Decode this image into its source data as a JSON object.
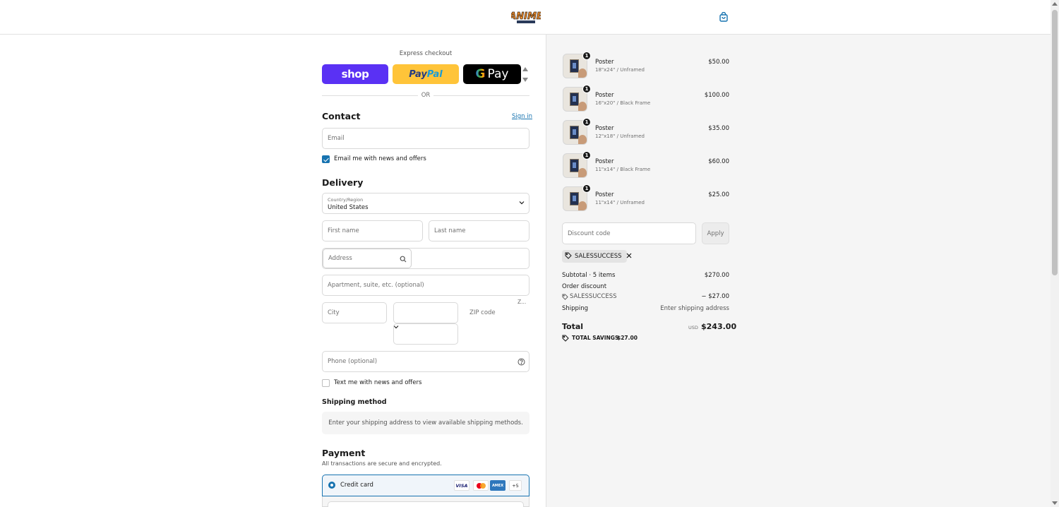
{
  "header": {
    "logo_text": "ANIME",
    "logo_sub": "ARTWORKS"
  },
  "express": {
    "label": "Express checkout",
    "shop": "shop",
    "paypal_a": "Pay",
    "paypal_b": "Pal",
    "gpay_g": "G",
    "gpay": "Pay",
    "or": "OR"
  },
  "contact": {
    "title": "Contact",
    "sign_in": "Sign in",
    "email_placeholder": "Email",
    "news_label": "Email me with news and offers"
  },
  "delivery": {
    "title": "Delivery",
    "country_label": "Country/Region",
    "country_value": "United States",
    "first_name": "First name",
    "last_name": "Last name",
    "address": "Address",
    "apartment": "Apartment, suite, etc. (optional)",
    "city": "City",
    "zip": "ZIP code",
    "zip_trunc": "Z...",
    "phone": "Phone (optional)",
    "text_label": "Text me with news and offers"
  },
  "shipping": {
    "title": "Shipping method",
    "info": "Enter your shipping address to view available shipping methods."
  },
  "payment": {
    "title": "Payment",
    "subtitle": "All transactions are secure and encrypted.",
    "credit_card": "Credit card",
    "visa": "VISA",
    "amex": "AMEX",
    "more": "+5"
  },
  "cart": {
    "items": [
      {
        "qty": "1",
        "name": "Poster",
        "variant": "18\"x24\" / Unframed",
        "price": "$50.00"
      },
      {
        "qty": "1",
        "name": "Poster",
        "variant": "16\"x20\" / Black Frame",
        "price": "$100.00"
      },
      {
        "qty": "1",
        "name": "Poster",
        "variant": "12\"x18\" / Unframed",
        "price": "$35.00"
      },
      {
        "qty": "1",
        "name": "Poster",
        "variant": "11\"x14\" / Black Frame",
        "price": "$60.00"
      },
      {
        "qty": "1",
        "name": "Poster",
        "variant": "11\"x14\" / Unframed",
        "price": "$25.00"
      }
    ],
    "discount_placeholder": "Discount code",
    "apply": "Apply",
    "applied_code": "SALESSUCCESS",
    "subtotal_label": "Subtotal · 5 items",
    "subtotal_value": "$270.00",
    "order_discount_label": "Order discount",
    "discount_code": "SALESSUCCESS",
    "discount_value": "− $27.00",
    "shipping_label": "Shipping",
    "shipping_value": "Enter shipping address",
    "total_label": "Total",
    "currency": "USD",
    "total_value": "$243.00",
    "savings_label": "TOTAL SAVINGS",
    "savings_value": "$27.00"
  },
  "colors": {
    "accent": "#1773b0",
    "shop": "#5a31f4",
    "paypal": "#ffc439"
  }
}
